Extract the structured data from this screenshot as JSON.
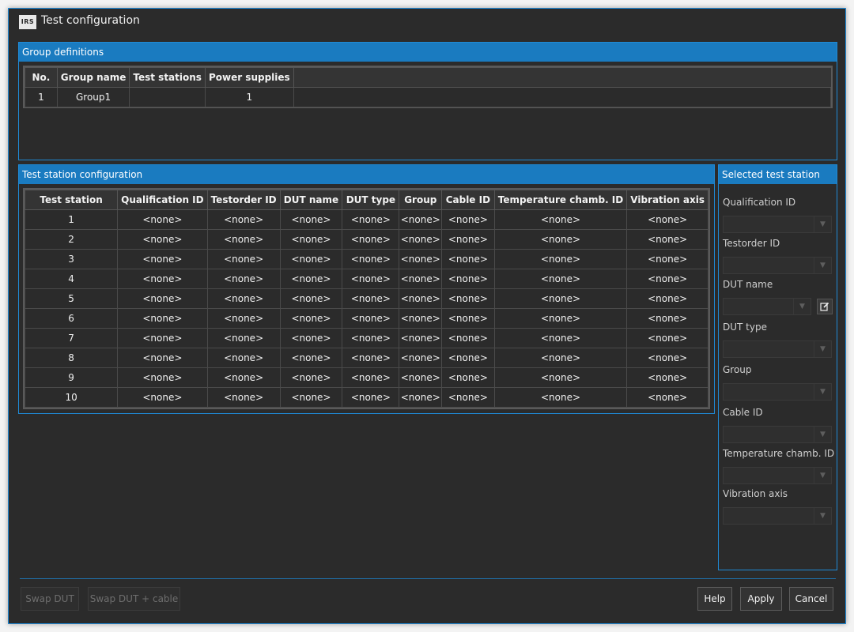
{
  "window": {
    "title": "Test configuration",
    "logo_text": "IRS"
  },
  "group_definitions": {
    "header": "Group definitions",
    "columns": [
      "No.",
      "Group name",
      "Test stations",
      "Power supplies"
    ],
    "rows": [
      [
        "1",
        "Group1",
        "",
        "1"
      ]
    ]
  },
  "test_station_config": {
    "header": "Test station configuration",
    "columns": [
      "Test station",
      "Qualification ID",
      "Testorder ID",
      "DUT name",
      "DUT type",
      "Group",
      "Cable ID",
      "Temperature chamb. ID",
      "Vibration axis"
    ],
    "rows": [
      [
        "1",
        "<none>",
        "<none>",
        "<none>",
        "<none>",
        "<none>",
        "<none>",
        "<none>",
        "<none>"
      ],
      [
        "2",
        "<none>",
        "<none>",
        "<none>",
        "<none>",
        "<none>",
        "<none>",
        "<none>",
        "<none>"
      ],
      [
        "3",
        "<none>",
        "<none>",
        "<none>",
        "<none>",
        "<none>",
        "<none>",
        "<none>",
        "<none>"
      ],
      [
        "4",
        "<none>",
        "<none>",
        "<none>",
        "<none>",
        "<none>",
        "<none>",
        "<none>",
        "<none>"
      ],
      [
        "5",
        "<none>",
        "<none>",
        "<none>",
        "<none>",
        "<none>",
        "<none>",
        "<none>",
        "<none>"
      ],
      [
        "6",
        "<none>",
        "<none>",
        "<none>",
        "<none>",
        "<none>",
        "<none>",
        "<none>",
        "<none>"
      ],
      [
        "7",
        "<none>",
        "<none>",
        "<none>",
        "<none>",
        "<none>",
        "<none>",
        "<none>",
        "<none>"
      ],
      [
        "8",
        "<none>",
        "<none>",
        "<none>",
        "<none>",
        "<none>",
        "<none>",
        "<none>",
        "<none>"
      ],
      [
        "9",
        "<none>",
        "<none>",
        "<none>",
        "<none>",
        "<none>",
        "<none>",
        "<none>",
        "<none>"
      ],
      [
        "10",
        "<none>",
        "<none>",
        "<none>",
        "<none>",
        "<none>",
        "<none>",
        "<none>",
        "<none>"
      ]
    ]
  },
  "selected_station": {
    "header": "Selected test station",
    "fields": [
      {
        "label": "Qualification ID",
        "value": ""
      },
      {
        "label": "Testorder ID",
        "value": ""
      },
      {
        "label": "DUT name",
        "value": "",
        "has_edit": true
      },
      {
        "label": "DUT type",
        "value": ""
      },
      {
        "label": "Group",
        "value": ""
      },
      {
        "label": "Cable ID",
        "value": ""
      },
      {
        "label": "Temperature chamb. ID",
        "value": ""
      },
      {
        "label": "Vibration axis",
        "value": ""
      }
    ]
  },
  "buttons": {
    "swap_dut": "Swap DUT",
    "swap_dut_cable": "Swap DUT + cable",
    "help": "Help",
    "apply": "Apply",
    "cancel": "Cancel"
  },
  "colors": {
    "accent": "#1a7bc0",
    "background": "#2b2b2b",
    "border": "#1f8ad6"
  }
}
